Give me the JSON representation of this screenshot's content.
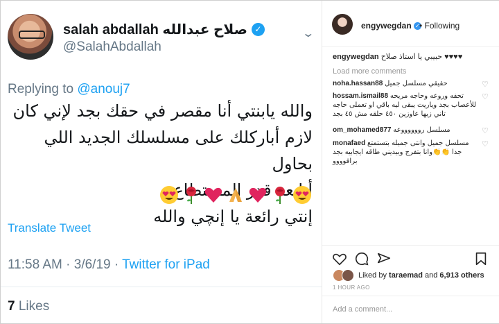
{
  "tweet": {
    "name": "salah abdallah صلاح عبدالله",
    "handle": "@SalahAbdallah",
    "replying_label": "Replying to ",
    "replying_mention": "@anouj7",
    "body_lines": [
      "والله يابنتي أنا مقصر في حقك بجد لإني كان",
      "لازم أباركلك على مسلسلك الجديد اللي بحاول",
      "أتابعه قدر المستطاع",
      "إنتي رائعة يا إنچي والله"
    ],
    "emojis": [
      "heart-eyes",
      "rose",
      "red-heart",
      "folded-hands",
      "red-heart",
      "rose",
      "heart-eyes"
    ],
    "translate": "Translate Tweet",
    "time": "11:58 AM · 3/6/19 · ",
    "source": "Twitter for iPad",
    "likes_count": "7",
    "likes_label": "Likes"
  },
  "instagram": {
    "username": "engywegdan",
    "following": "• Following",
    "caption_user": "engywegdan",
    "caption_text": "حبيبي يا استاذ صلاح ♥♥♥♥",
    "load_more": "Load more comments",
    "comments": [
      {
        "user": "noha.hassan88",
        "text": "حقيقي مسلسل جميل"
      },
      {
        "user": "hossam.ismail88",
        "text": "تحفه وروعه وحاجه مريحه للأعصاب بجد وياريت يبقى ليه باقي او تعملى حاجه تاني زيها عاوزين ٤٥٠ حلقه مش ٤٥ بجد"
      },
      {
        "user": "om_mohamed877",
        "text": "مسلسل رووووووعه"
      },
      {
        "user": "monafaed",
        "text": "مسلسل جميل وانتى جميله بتستمتع جدا 👏👏وانا بتفرج وبيديني طاقه ايجابيه بجد برافوووو"
      }
    ],
    "liked_by_label": "Liked by ",
    "liked_by_user": "taraemad",
    "liked_and": " and ",
    "liked_others": "6,913 others",
    "time_ago": "1 HOUR AGO",
    "add_comment_placeholder": "Add a comment..."
  },
  "colors": {
    "twitter_blue": "#1da1f2",
    "twitter_gray": "#657786",
    "instagram_text": "#262626"
  },
  "icons": [
    "chevron-down-icon",
    "verified-badge-icon",
    "heart-outline-icon",
    "comment-icon",
    "share-icon",
    "bookmark-icon"
  ]
}
